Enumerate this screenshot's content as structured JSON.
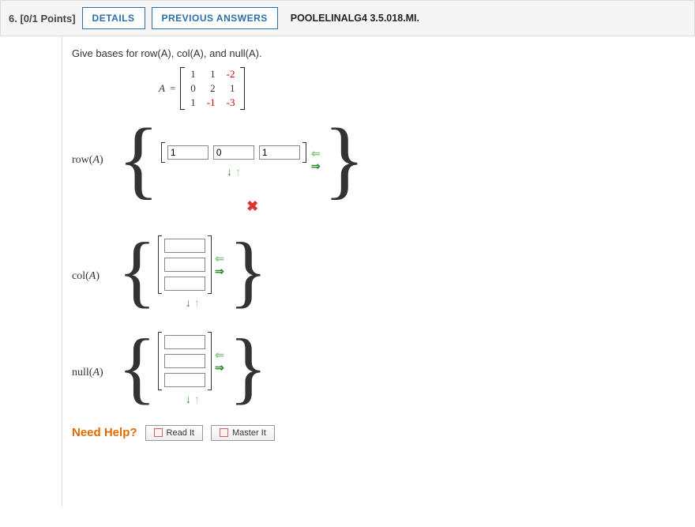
{
  "header": {
    "number": "6.",
    "points": "[0/1 Points]",
    "details": "DETAILS",
    "previous": "PREVIOUS ANSWERS",
    "ref": "POOLELINALG4 3.5.018.MI."
  },
  "prompt": "Give bases for row(A), col(A), and null(A).",
  "matrix": {
    "var": "A",
    "eq": "=",
    "rows": [
      [
        "1",
        "1",
        "-2"
      ],
      [
        "0",
        "2",
        "1"
      ],
      [
        "1",
        "-1",
        "-3"
      ]
    ]
  },
  "labels": {
    "rowA_pre": "row(",
    "rowA_var": "A",
    "rowA_post": ")",
    "colA_pre": "col(",
    "colA_var": "A",
    "colA_post": ")",
    "nullA_pre": "null(",
    "nullA_var": "A",
    "nullA_post": ")"
  },
  "rowA": {
    "v1": "1",
    "v2": "0",
    "v3": "1"
  },
  "help": {
    "label": "Need Help?",
    "read": "Read It",
    "master": "Master It"
  }
}
